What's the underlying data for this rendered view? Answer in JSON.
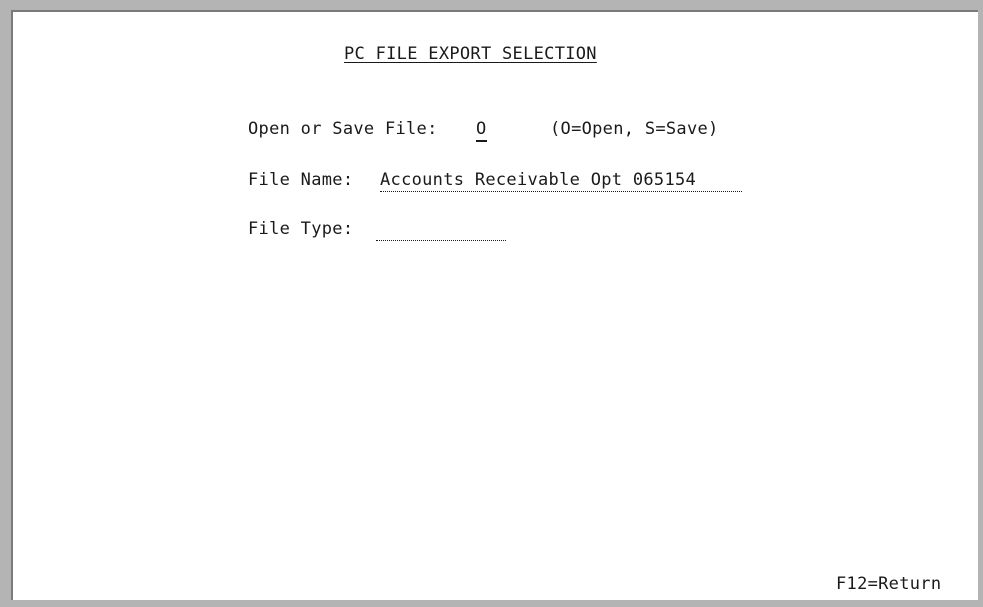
{
  "screen": {
    "title": "PC FILE EXPORT SELECTION",
    "open_save": {
      "label": "Open or Save File:",
      "value": "O",
      "hint": "(O=Open, S=Save)"
    },
    "file_name": {
      "label": "File Name:",
      "value": "Accounts Receivable Opt 065154"
    },
    "file_type": {
      "label": "File Type:",
      "value": ""
    },
    "footer": {
      "f12": "F12=Return"
    }
  },
  "colors": {
    "background": "#ffffff",
    "text": "#1a1a1a",
    "frame": "#b4b4b4"
  }
}
